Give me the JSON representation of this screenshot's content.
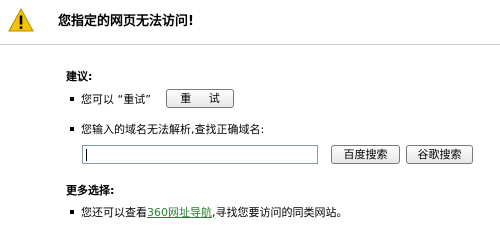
{
  "header": {
    "title": "您指定的网页无法访问!"
  },
  "suggestions": {
    "label": "建议:",
    "retry_text": "您可以 “重试”",
    "retry_button": "重 试",
    "domain_text": "您输入的域名无法解析,查找正确域名:",
    "domain_input_value": "",
    "baidu_button": "百度搜索",
    "google_button": "谷歌搜索"
  },
  "more": {
    "label": "更多选择:",
    "before_link": "您还可以查看",
    "link_text": "360网址导航",
    "after_link": ",寻找您要访问的同类网站。"
  },
  "icons": {
    "warning": "warning-icon"
  },
  "colors": {
    "warning_fill": "#f5c400",
    "link": "#2e7d32",
    "divider": "#c9c9c9"
  }
}
